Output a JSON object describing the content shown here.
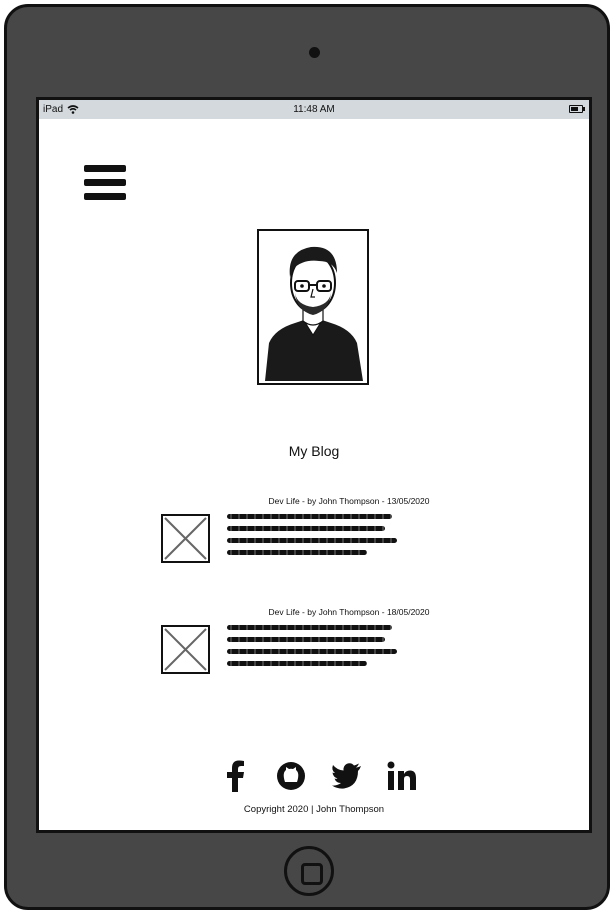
{
  "statusbar": {
    "device": "iPad",
    "time": "11:48 AM"
  },
  "menu": {
    "icon": "hamburger-menu-icon"
  },
  "profile": {
    "image": "portrait-sketch-image"
  },
  "blog": {
    "title": "My Blog",
    "posts": [
      {
        "meta": "Dev Life - by John Thompson - 13/05/2020",
        "thumbnail": "placeholder-image-icon"
      },
      {
        "meta": "Dev Life - by John Thompson - 18/05/2020",
        "thumbnail": "placeholder-image-icon"
      }
    ]
  },
  "footer": {
    "social": [
      "facebook-icon",
      "github-icon",
      "twitter-icon",
      "linkedin-icon"
    ],
    "copyright": "Copyright 2020 | John Thompson"
  },
  "colors": {
    "device": "#474747",
    "statusbar": "#d3d9dc",
    "ink": "#111111"
  }
}
